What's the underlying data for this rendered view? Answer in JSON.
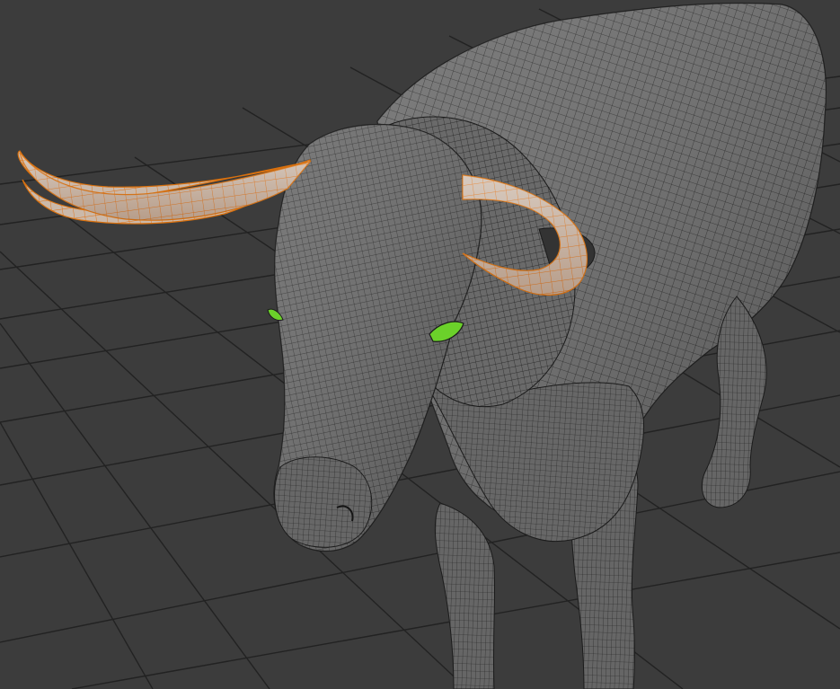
{
  "viewport": {
    "background_color": "#3c3c3c",
    "grid_color": "#232323",
    "mesh_surface_color": "#6e6e6e",
    "mesh_wire_color": "#1c1c1c",
    "selected_horn_color": "#c9b7a8",
    "selected_wire_color": "#e0720f",
    "eye_color": "#6bd12a"
  },
  "scene": {
    "model": "bull-wireframe-mesh",
    "selected_parts": [
      "left-horn",
      "right-horn"
    ],
    "highlighted_parts": [
      "left-eye",
      "right-eye"
    ]
  }
}
